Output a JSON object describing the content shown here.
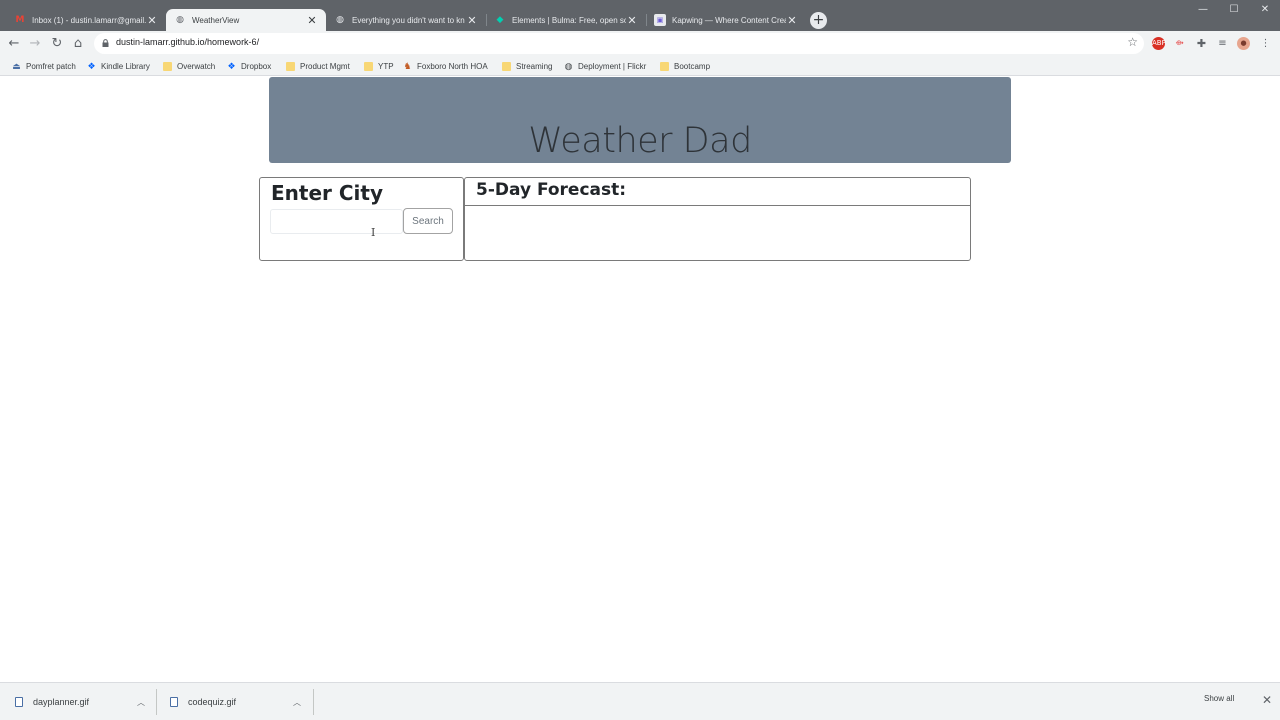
{
  "browser": {
    "tabs": [
      {
        "title": "Inbox (1) - dustin.lamarr@gmail.",
        "icon": "gmail-icon",
        "active": false
      },
      {
        "title": "WeatherView",
        "icon": "globe-icon",
        "active": true
      },
      {
        "title": "Everything you didn't want to kn",
        "icon": "globe-icon",
        "active": false
      },
      {
        "title": "Elements | Bulma: Free, open sou",
        "icon": "bulma-icon",
        "active": false
      },
      {
        "title": "Kapwing — Where Content Crea",
        "icon": "kapwing-icon",
        "active": false
      }
    ],
    "url": "dustin-lamarr.github.io/homework-6/",
    "bookmarks": [
      {
        "label": "Pomfret patch",
        "icon": "pin-icon"
      },
      {
        "label": "Kindle Library",
        "icon": "dropbox-icon"
      },
      {
        "label": "Overwatch",
        "icon": "folder-icon"
      },
      {
        "label": "Dropbox",
        "icon": "dropbox-icon"
      },
      {
        "label": "Product Mgmt",
        "icon": "folder-icon"
      },
      {
        "label": "YTP",
        "icon": "folder-icon"
      },
      {
        "label": "Foxboro North HOA",
        "icon": "fox-icon"
      },
      {
        "label": "Streaming",
        "icon": "folder-icon"
      },
      {
        "label": "Deployment | Flickr",
        "icon": "globe-icon"
      },
      {
        "label": "Bootcamp",
        "icon": "folder-icon"
      }
    ]
  },
  "page": {
    "header_title": "Weather Dad",
    "search_card": {
      "heading": "Enter City",
      "input_value": "",
      "input_placeholder": "",
      "button_label": "Search"
    },
    "forecast_card": {
      "heading": "5-Day Forecast:"
    }
  },
  "downloads": {
    "items": [
      {
        "name": "dayplanner.gif"
      },
      {
        "name": "codequiz.gif"
      }
    ],
    "show_all_label": "Show all"
  },
  "colors": {
    "jumbotron": "#738394",
    "tabstrip": "#5f6368",
    "toolbar": "#f1f3f4"
  }
}
